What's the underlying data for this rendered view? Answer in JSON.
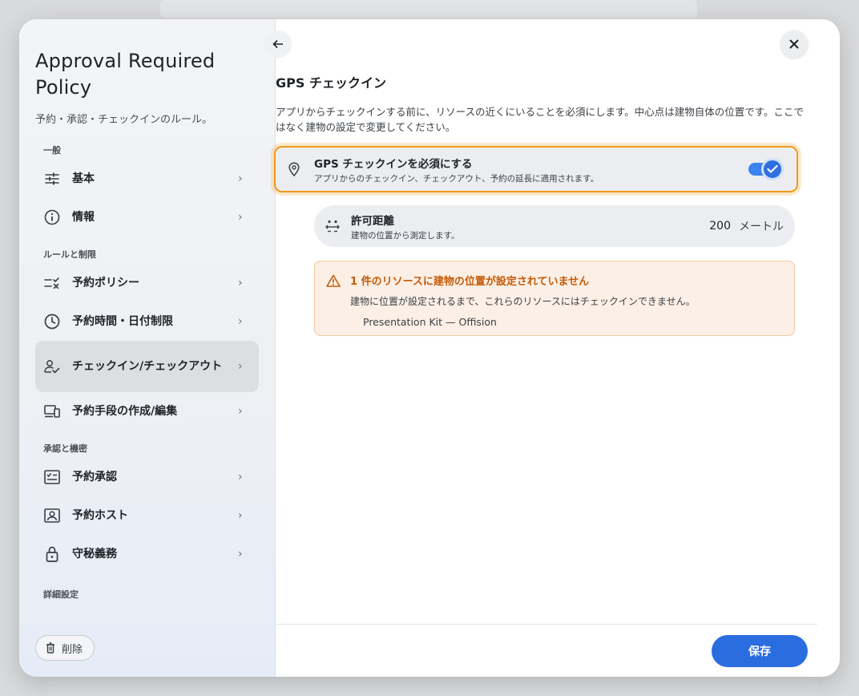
{
  "sidebar": {
    "title": "Approval Required Policy",
    "subtitle": "予約・承認・チェックインのルール。",
    "sections": {
      "general": "一般",
      "rules": "ルールと制限",
      "approval": "承認と機密",
      "advanced": "詳細設定"
    },
    "items": [
      {
        "label": "基本",
        "icon": "sliders-icon"
      },
      {
        "label": "情報",
        "icon": "info-icon"
      },
      {
        "label": "予約ポリシー",
        "icon": "checklist-icon"
      },
      {
        "label": "予約時間・日付制限",
        "icon": "clock-icon"
      },
      {
        "label": "チェックイン/チェックアウト",
        "icon": "person-check-icon"
      },
      {
        "label": "予約手段の作成/編集",
        "icon": "devices-icon"
      },
      {
        "label": "予約承認",
        "icon": "approval-icon"
      },
      {
        "label": "予約ホスト",
        "icon": "host-icon"
      },
      {
        "label": "守秘義務",
        "icon": "lock-icon"
      }
    ],
    "delete_label": "削除"
  },
  "main": {
    "title": "GPS チェックイン",
    "description": "アプリからチェックインする前に、リソースの近くにいることを必須にします。中心点は建物自体の位置です。ここではなく建物の設定で変更してください。",
    "gps_toggle": {
      "label": "GPS チェックインを必須にする",
      "sublabel": "アプリからのチェックイン、チェックアウト、予約の延長に適用されます。",
      "enabled": true
    },
    "distance": {
      "label": "許可距離",
      "sublabel": "建物の位置から測定します。",
      "value": "200",
      "unit": "メートル"
    },
    "warning": {
      "title": "1 件のリソースに建物の位置が設定されていません",
      "description": "建物に位置が設定されるまで、これらのリソースにはチェックインできません。",
      "resource": "Presentation Kit — Offision"
    },
    "save_label": "保存"
  },
  "colors": {
    "accent": "#2a6de0",
    "warning_border": "#f29a1a",
    "warning_text": "#c55a06"
  }
}
